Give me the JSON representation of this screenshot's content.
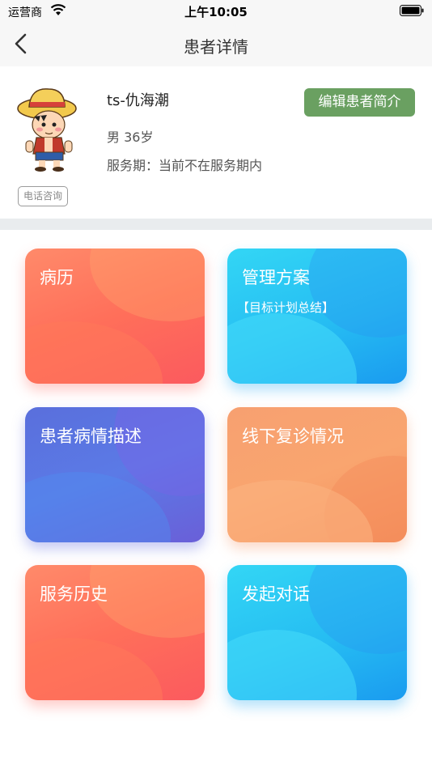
{
  "status_bar": {
    "carrier": "运营商",
    "time": "上午10:05"
  },
  "nav": {
    "title": "患者详情",
    "back_icon": "chevron-left-icon"
  },
  "patient": {
    "name": "ts-仇海潮",
    "gender_age": "男 36岁",
    "service_period": "服务期：当前不在服务期内",
    "edit_button": "编辑患者简介",
    "tag": "电话咨询"
  },
  "cards": [
    {
      "label": "病历",
      "sublabel": ""
    },
    {
      "label": "管理方案",
      "sublabel": "【目标计划总结】"
    },
    {
      "label": "患者病情描述",
      "sublabel": ""
    },
    {
      "label": "线下复诊情况",
      "sublabel": ""
    },
    {
      "label": "服务历史",
      "sublabel": ""
    },
    {
      "label": "发起对话",
      "sublabel": ""
    }
  ],
  "colors": {
    "edit_button": "#6aa061",
    "card_red": "#ff6f5a",
    "card_blue": "#26bdf2",
    "card_purple": "#5b6fdc",
    "card_orange": "#f7a070"
  }
}
